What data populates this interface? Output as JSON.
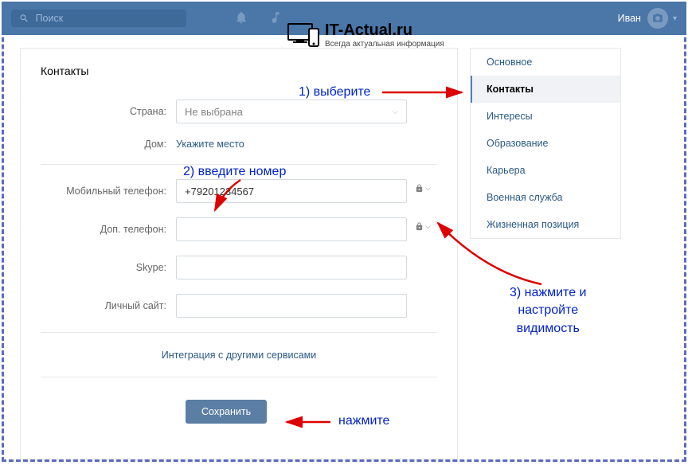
{
  "topbar": {
    "search_placeholder": "Поиск",
    "username": "Иван"
  },
  "watermark": {
    "main": "IT-Actual.ru",
    "sub": "Всегда актуальная информация"
  },
  "page_title": "Контакты",
  "form": {
    "country_label": "Страна:",
    "country_placeholder": "Не выбрана",
    "home_label": "Дом:",
    "home_placeholder": "Укажите место",
    "mobile_label": "Мобильный телефон:",
    "mobile_value": "+79201234567",
    "alt_phone_label": "Доп. телефон:",
    "skype_label": "Skype:",
    "site_label": "Личный сайт:",
    "integration": "Интеграция с другими сервисами",
    "save": "Сохранить"
  },
  "sidebar": {
    "items": [
      "Основное",
      "Контакты",
      "Интересы",
      "Образование",
      "Карьера",
      "Военная служба",
      "Жизненная позиция"
    ],
    "active_index": 1
  },
  "annotations": {
    "a1": "1) выберите",
    "a2": "2) введите номер",
    "a3_line1": "3) нажмите и",
    "a3_line2": "настройте",
    "a3_line3": "видимость",
    "a4": "нажмите"
  }
}
